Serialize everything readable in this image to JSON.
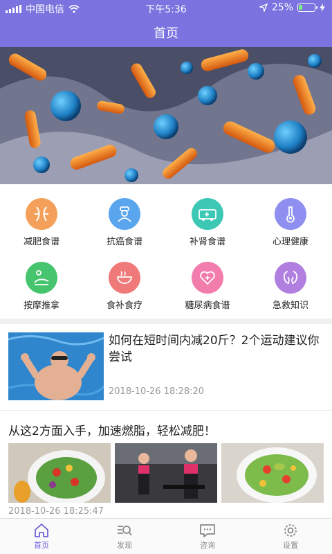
{
  "status_bar": {
    "carrier": "中国电信",
    "time": "下午5:36",
    "battery": "25%",
    "battery_level": 0.25
  },
  "nav": {
    "title": "首页"
  },
  "banner": {
    "alt": ""
  },
  "categories": [
    {
      "label": "减肥食谱",
      "icon": "weight-loss-icon",
      "color": "#f5a05a"
    },
    {
      "label": "抗癌食谱",
      "icon": "doctor-icon",
      "color": "#5aa6ee"
    },
    {
      "label": "补肾食谱",
      "icon": "ambulance-icon",
      "color": "#3cc8b4"
    },
    {
      "label": "心理健康",
      "icon": "thermometer-icon",
      "color": "#8e8ff0"
    },
    {
      "label": "按摩推拿",
      "icon": "massage-icon",
      "color": "#47c46e"
    },
    {
      "label": "食补食疗",
      "icon": "bowl-icon",
      "color": "#f07a7a"
    },
    {
      "label": "糖尿病食谱",
      "icon": "heart-plus-icon",
      "color": "#f27cab"
    },
    {
      "label": "急救知识",
      "icon": "kidney-icon",
      "color": "#b07fe0"
    }
  ],
  "articles": [
    {
      "title": "如何在短时间内减20斤？2个运动建议你尝试",
      "time": "2018-10-26 18:28:20"
    },
    {
      "title": "从这2方面入手，加速燃脂，轻松减肥！",
      "time": "2018-10-26 18:25:47"
    }
  ],
  "tabs": [
    {
      "label": "首页",
      "icon": "home-icon",
      "active": true
    },
    {
      "label": "发现",
      "icon": "discover-icon",
      "active": false
    },
    {
      "label": "咨询",
      "icon": "chat-icon",
      "active": false
    },
    {
      "label": "设置",
      "icon": "settings-icon",
      "active": false
    }
  ],
  "colors": {
    "primary": "#7b73df",
    "tab_active": "#6c63d9",
    "muted_text": "#999999"
  }
}
